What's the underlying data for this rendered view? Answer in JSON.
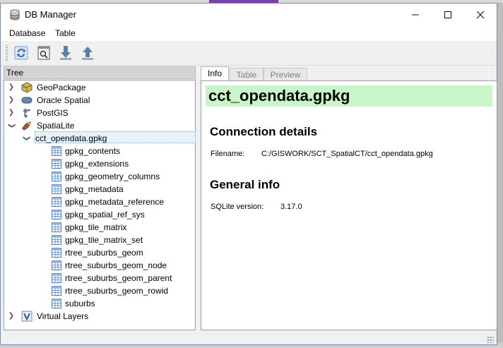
{
  "window": {
    "title": "DB Manager"
  },
  "menu": {
    "items": [
      "Database",
      "Table"
    ]
  },
  "toolbar": {
    "buttons": [
      {
        "icon": "refresh-icon"
      },
      {
        "icon": "sql-window-icon"
      },
      {
        "icon": "import-layer-icon"
      },
      {
        "icon": "export-icon"
      }
    ]
  },
  "tree": {
    "header": "Tree",
    "providers": [
      {
        "label": "GeoPackage",
        "icon": "geopackage-icon",
        "expanded": false
      },
      {
        "label": "Oracle Spatial",
        "icon": "oracle-icon",
        "expanded": false
      },
      {
        "label": "PostGIS",
        "icon": "postgis-icon",
        "expanded": false
      },
      {
        "label": "SpatiaLite",
        "icon": "spatialite-icon",
        "expanded": true
      }
    ],
    "database": "cct_opendata.gpkg",
    "tables": [
      "gpkg_contents",
      "gpkg_extensions",
      "gpkg_geometry_columns",
      "gpkg_metadata",
      "gpkg_metadata_reference",
      "gpkg_spatial_ref_sys",
      "gpkg_tile_matrix",
      "gpkg_tile_matrix_set",
      "rtree_suburbs_geom",
      "rtree_suburbs_geom_node",
      "rtree_suburbs_geom_parent",
      "rtree_suburbs_geom_rowid",
      "suburbs"
    ],
    "virtual_layers": "Virtual Layers"
  },
  "tabs": [
    {
      "label": "Info",
      "active": true
    },
    {
      "label": "Table",
      "active": false
    },
    {
      "label": "Preview",
      "active": false
    }
  ],
  "info": {
    "title": "cct_opendata.gpkg",
    "connection_heading": "Connection details",
    "filename_label": "Filename:",
    "filename_value": "C:/GISWORK/SCT_SpatialCT/cct_opendata.gpkg",
    "general_heading": "General info",
    "sqlite_label": "SQLite version:",
    "sqlite_value": "3.17.0"
  },
  "colors": {
    "title_highlight": "#c8f6c8",
    "selection": "#e5f1fb",
    "window_border": "#6e8cb5"
  }
}
